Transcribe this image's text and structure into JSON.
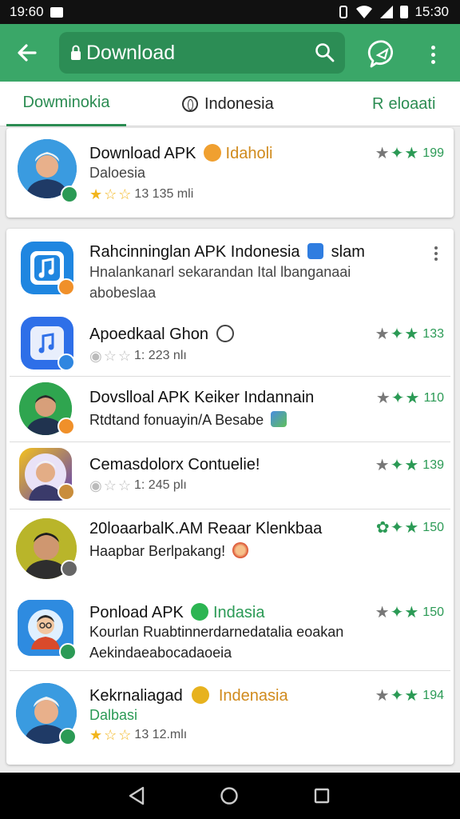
{
  "status": {
    "time_left": "19:60",
    "time_right": "15:30"
  },
  "toolbar": {
    "url": "Download"
  },
  "tabs": [
    {
      "label": "Dowminokia"
    },
    {
      "label": "Indonesia"
    },
    {
      "label": "eloaati",
      "prefix": "R"
    }
  ],
  "featured": {
    "title": "Download APK",
    "tag": "Idaholi",
    "subtitle": "Daloesia",
    "meta": "13  135 mli",
    "score": "199"
  },
  "items": [
    {
      "title": "Rahcinninglan APK Indonesia",
      "tag": "slam",
      "line2": "Hnalankanarl sekarandan Ital lbanganaai",
      "line3": "abobeslaa"
    },
    {
      "title": "Apoedkaal Ghon",
      "meta": "1:  223 nlı",
      "score": "133"
    },
    {
      "title": "Dovslloal APK Keiker Indannain",
      "line2": "Rtdtand fonuayin/A Besabe",
      "score": "110"
    },
    {
      "title": "Cemasdolorx Contuelie!",
      "meta": "1:  245 plı",
      "score": "139"
    },
    {
      "title": "20loaarbalK.AM Reaar Klenkbaa",
      "line2": "Haapbar Berlpakang!",
      "score": "150"
    },
    {
      "title": "Ponload APK",
      "tag": "Indasia",
      "line2": "Kourlan Ruabtinnerdarnedatalia eoakan",
      "line3": "Aekindaeabocadaoeia",
      "score": "150"
    },
    {
      "title": "Kekrnaliagad",
      "tag": "Indenasia",
      "subtitle": "Dalbasi",
      "meta": "13  12.mlı",
      "score": "194"
    }
  ],
  "colors": {
    "primary": "#3aa768",
    "primary_dark": "#2c8d55",
    "accent_green": "#2b9a55",
    "accent_orange": "#d08a1c"
  }
}
